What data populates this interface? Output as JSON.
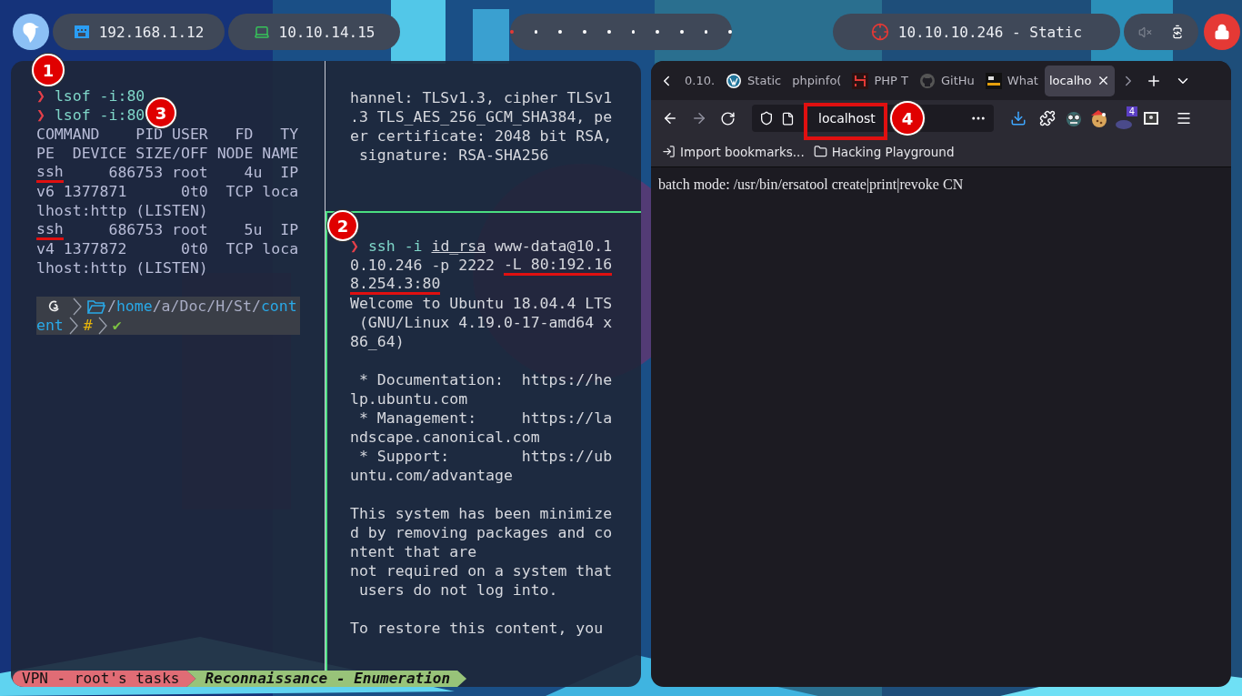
{
  "top_bar": {
    "local_ip": "192.168.1.12",
    "vpn_ip": "10.10.14.15",
    "workspaces": [
      {
        "selected": true
      },
      {
        "selected": false
      },
      {
        "selected": false
      },
      {
        "selected": false
      },
      {
        "selected": false
      },
      {
        "selected": false
      },
      {
        "selected": false
      },
      {
        "selected": false
      },
      {
        "selected": false
      },
      {
        "selected": false
      }
    ],
    "target": "10.10.10.246 - Static"
  },
  "terminal": {
    "left_pane": [
      {
        "segments": [
          {
            "kind": "arrow",
            "text": "❯"
          },
          {
            "kind": "command",
            "text": "lsof -i:80"
          }
        ]
      },
      {
        "segments": [
          {
            "kind": "arrow",
            "text": "❯"
          },
          {
            "kind": "command",
            "text": "lsof -i:80"
          }
        ]
      },
      {
        "segments": [
          {
            "kind": "plain",
            "text": "COMMAND    PID USER   FD   TY"
          }
        ]
      },
      {
        "segments": [
          {
            "kind": "plain",
            "text": "PE  DEVICE SIZE/OFF NODE NAME"
          }
        ]
      },
      {
        "segments": [
          {
            "kind": "plain",
            "text": "ssh",
            "marked": true
          },
          {
            "kind": "plain",
            "text": "     686753 root    4u  IP"
          }
        ]
      },
      {
        "segments": [
          {
            "kind": "plain",
            "text": "v6 1377871      0t0  TCP loca"
          }
        ]
      },
      {
        "segments": [
          {
            "kind": "plain",
            "text": "lhost:http (LISTEN)"
          }
        ]
      },
      {
        "segments": [
          {
            "kind": "plain",
            "text": "ssh",
            "marked": true
          },
          {
            "kind": "plain",
            "text": "     686753 root    5u  IP"
          }
        ]
      },
      {
        "segments": [
          {
            "kind": "plain",
            "text": "v4 1377872      0t0  TCP loca"
          }
        ]
      },
      {
        "segments": [
          {
            "kind": "plain",
            "text": "lhost:http (LISTEN)"
          }
        ]
      },
      {
        "kind": "blank"
      },
      {
        "kind": "prompt",
        "segments": [
          {
            "kind": "distro-icon"
          },
          {
            "kind": "separator"
          },
          {
            "kind": "folder-icon"
          },
          {
            "kind": "dim",
            "text": "/"
          },
          {
            "kind": "dir",
            "text": "home"
          },
          {
            "kind": "dim",
            "text": "/a/Doc/H/St/"
          },
          {
            "kind": "dir",
            "text": "cont"
          }
        ]
      },
      {
        "kind": "prompt",
        "segments": [
          {
            "kind": "dir",
            "text": "ent"
          },
          {
            "kind": "separator"
          },
          {
            "kind": "root",
            "text": "#"
          },
          {
            "kind": "separator"
          },
          {
            "kind": "ok",
            "text": "✔"
          }
        ]
      }
    ],
    "top_right_pane": [
      {
        "segments": [
          {
            "kind": "plain",
            "text": "hannel: TLSv1.3, cipher TLSv1"
          }
        ]
      },
      {
        "segments": [
          {
            "kind": "plain",
            "text": ".3 TLS_AES_256_GCM_SHA384, pe"
          }
        ]
      },
      {
        "segments": [
          {
            "kind": "plain",
            "text": "er certificate: 2048 bit RSA,"
          }
        ]
      },
      {
        "segments": [
          {
            "kind": "plain",
            "text": " signature: RSA-SHA256"
          }
        ]
      }
    ],
    "bottom_right_pane": [
      {
        "segments": [
          {
            "kind": "arrow",
            "text": "❯"
          },
          {
            "kind": "command",
            "text": "ssh -i "
          },
          {
            "kind": "underline",
            "text": "id_rsa"
          },
          {
            "kind": "plain",
            "text": " www-data@10.1"
          }
        ]
      },
      {
        "segments": [
          {
            "kind": "plain",
            "text": "0.10.246 -p 2222 "
          },
          {
            "kind": "plain",
            "text": "-L 80:192.16",
            "marked": true
          }
        ]
      },
      {
        "segments": [
          {
            "kind": "plain",
            "text": "8.254.3:80",
            "marked": true
          }
        ]
      },
      {
        "segments": [
          {
            "kind": "plain",
            "text": "Welcome to Ubuntu 18.04.4 LTS"
          }
        ]
      },
      {
        "segments": [
          {
            "kind": "plain",
            "text": " (GNU/Linux 4.19.0-17-amd64 x"
          }
        ]
      },
      {
        "segments": [
          {
            "kind": "plain",
            "text": "86_64)"
          }
        ]
      },
      {
        "kind": "blank"
      },
      {
        "segments": [
          {
            "kind": "plain",
            "text": " * Documentation:  https://he"
          }
        ]
      },
      {
        "segments": [
          {
            "kind": "plain",
            "text": "lp.ubuntu.com"
          }
        ]
      },
      {
        "segments": [
          {
            "kind": "plain",
            "text": " * Management:     https://la"
          }
        ]
      },
      {
        "segments": [
          {
            "kind": "plain",
            "text": "ndscape.canonical.com"
          }
        ]
      },
      {
        "segments": [
          {
            "kind": "plain",
            "text": " * Support:        https://ub"
          }
        ]
      },
      {
        "segments": [
          {
            "kind": "plain",
            "text": "untu.com/advantage"
          }
        ]
      },
      {
        "kind": "blank"
      },
      {
        "segments": [
          {
            "kind": "plain",
            "text": "This system has been minimize"
          }
        ]
      },
      {
        "segments": [
          {
            "kind": "plain",
            "text": "d by removing packages and co"
          }
        ]
      },
      {
        "segments": [
          {
            "kind": "plain",
            "text": "ntent that are"
          }
        ]
      },
      {
        "segments": [
          {
            "kind": "plain",
            "text": "not required on a system that"
          }
        ]
      },
      {
        "segments": [
          {
            "kind": "plain",
            "text": " users do not log into."
          }
        ]
      },
      {
        "kind": "blank"
      },
      {
        "segments": [
          {
            "kind": "plain",
            "text": "To restore this content, you"
          }
        ]
      }
    ],
    "status_bar": [
      {
        "text": "VPN - root's tasks",
        "color": "#e06c75",
        "emphasis": false
      },
      {
        "text": "Reconnaissance - Enumeration",
        "color": "#98c379",
        "emphasis": true
      }
    ]
  },
  "browser": {
    "tabs": [
      {
        "label": "0.10.",
        "selected": false
      },
      {
        "label": "Static",
        "selected": false
      },
      {
        "label": "phpinfo(",
        "selected": false
      },
      {
        "label": "PHP T",
        "selected": false
      },
      {
        "label": "GitHu",
        "selected": false
      },
      {
        "label": "What",
        "selected": false
      },
      {
        "label": "localho",
        "selected": true
      }
    ],
    "url": "localhost",
    "url_highlighted": true,
    "extension_badge": "4",
    "bookmarks": [
      "Import bookmarks...",
      "Hacking Playground"
    ],
    "content": "batch mode: /usr/bin/ersatool create|print|revoke CN"
  },
  "annotations": [
    {
      "label": "1"
    },
    {
      "label": "2"
    },
    {
      "label": "3"
    },
    {
      "label": "4"
    }
  ]
}
